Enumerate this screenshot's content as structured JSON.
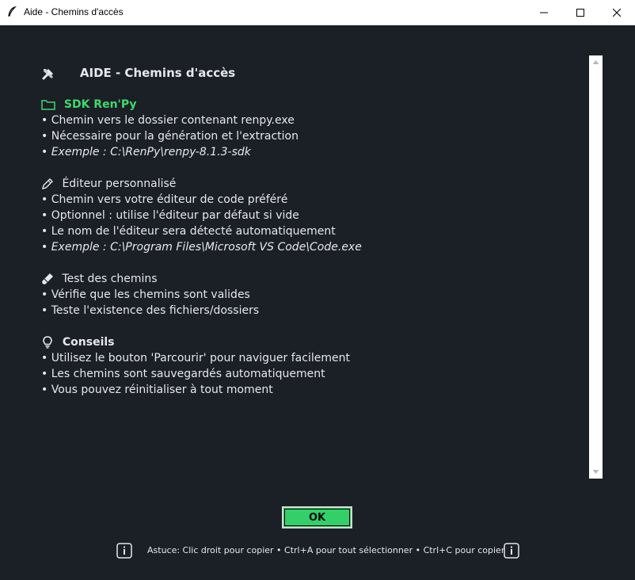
{
  "window": {
    "title": "Aide - Chemins d'accès",
    "app_icon": "feather-icon"
  },
  "help": {
    "heading": "AIDE - Chemins d'accès",
    "sections": [
      {
        "title": "SDK Ren'Py",
        "icon": "folder-icon",
        "lines": [
          "• Chemin vers le dossier contenant renpy.exe",
          "• Nécessaire pour la génération et l'extraction",
          "• Exemple : C:\\RenPy\\renpy-8.1.3-sdk"
        ]
      },
      {
        "title": "Éditeur personnalisé",
        "icon": "pencil-icon",
        "lines": [
          "• Chemin vers votre éditeur de code préféré",
          "• Optionnel : utilise l'éditeur par défaut si vide",
          "• Le nom de l'éditeur sera détecté automatiquement",
          "• Exemple : C:\\Program Files\\Microsoft VS Code\\Code.exe"
        ]
      },
      {
        "title": "Test des chemins",
        "icon": "test-tube-icon",
        "lines": [
          "• Vérifie que les chemins sont valides",
          "• Teste l'existence des fichiers/dossiers"
        ]
      },
      {
        "title": "Conseils",
        "icon": "lightbulb-icon",
        "lines": [
          "• Utilisez le bouton 'Parcourir' pour naviguer facilement",
          "• Les chemins sont sauvegardés automatiquement",
          "• Vous pouvez réinitialiser à tout moment"
        ]
      }
    ]
  },
  "buttons": {
    "ok": "OK"
  },
  "footer": {
    "tip": "Astuce: Clic droit pour copier • Ctrl+A pour tout sélectionner • Ctrl+C pour copier"
  },
  "colors": {
    "background": "#1b1f26",
    "accent_green": "#3fd96b",
    "ok_button": "#33d06a",
    "text": "#e6e8ec"
  }
}
